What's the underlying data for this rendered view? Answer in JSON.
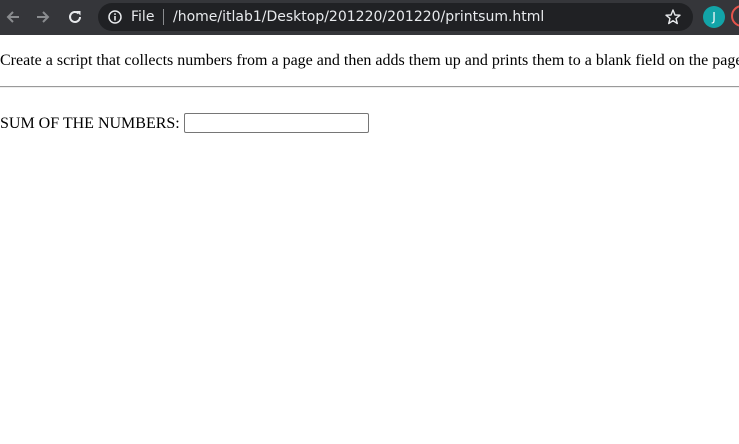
{
  "browser": {
    "scheme_label": "File",
    "url": "/home/itlab1/Desktop/201220/201220/printsum.html",
    "profile_initial": "J",
    "colors": {
      "toolbar_bg": "#35363a",
      "omnibox_bg": "#202124",
      "avatar_bg": "#12a4a8",
      "extension_ring": "#e5534b"
    },
    "icons": [
      "back-arrow-icon",
      "forward-arrow-icon",
      "reload-icon",
      "info-icon",
      "star-icon",
      "extension-icon"
    ]
  },
  "page": {
    "instruction": "Create a script that collects numbers from a page and then adds them up and prints them to a blank field on the page.",
    "sum_label": "SUM OF THE NUMBERS:",
    "sum_value": ""
  }
}
